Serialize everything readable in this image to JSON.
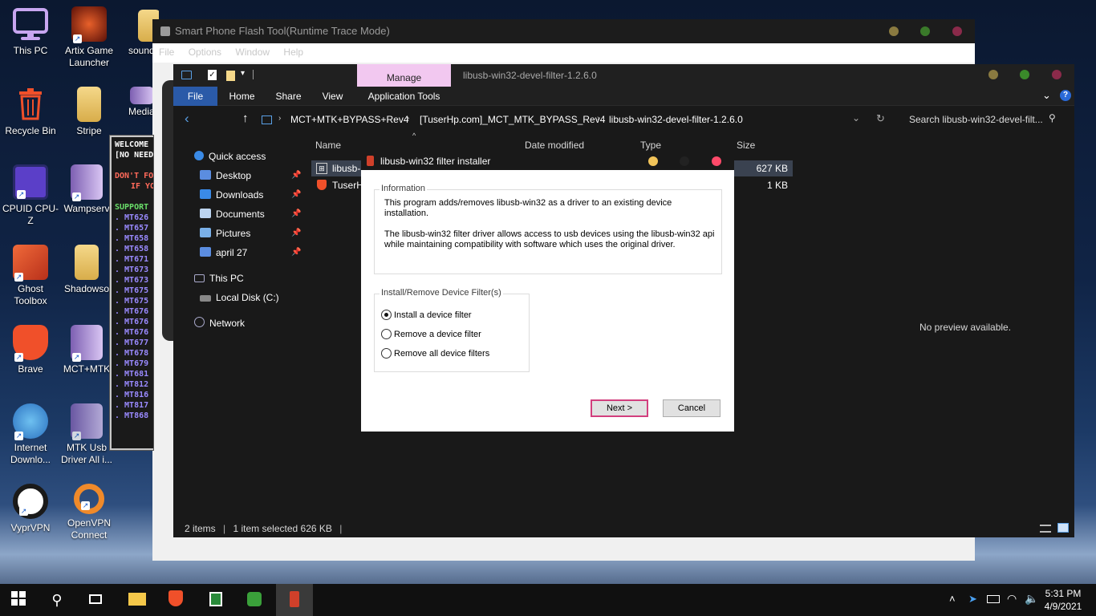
{
  "desktop": {
    "icons": [
      {
        "label": "This PC"
      },
      {
        "label": "Artix Game Launcher"
      },
      {
        "label": "sound"
      },
      {
        "label": "Recycle Bin"
      },
      {
        "label": "Stripe"
      },
      {
        "label": "Media"
      },
      {
        "label": "CPUID CPU-Z"
      },
      {
        "label": "Wampserv"
      },
      {
        "label": "Ghost Toolbox"
      },
      {
        "label": "Shadowso"
      },
      {
        "label": "Brave"
      },
      {
        "label": "MCT+MTK"
      },
      {
        "label": "Internet Downlo..."
      },
      {
        "label": "MTK Usb Driver All i..."
      },
      {
        "label": "VyprVPN"
      },
      {
        "label": "OpenVPN Connect"
      }
    ]
  },
  "cmd_panel": {
    "lines": [
      "WELCOME",
      "[NO NEED",
      "",
      "DON'T FO",
      "IF YO",
      "",
      "SUPPORT",
      "MT626",
      "MT657",
      "MT658",
      "MT658",
      "MT671",
      "MT673",
      "MT673",
      "MT675",
      "MT675",
      "MT676",
      "MT676",
      "MT676",
      "MT677",
      "MT678",
      "MT679",
      "MT681",
      "MT812",
      "MT816",
      "MT817",
      "MT868"
    ]
  },
  "flash_tool": {
    "title": "Smart Phone Flash Tool(Runtime Trace Mode)",
    "menu": [
      "File",
      "Options",
      "Window",
      "Help"
    ]
  },
  "explorer": {
    "context_tab": "Manage",
    "window_title": "libusb-win32-devel-filter-1.2.6.0",
    "tabs": [
      "File",
      "Home",
      "Share",
      "View",
      "Application Tools"
    ],
    "breadcrumb": [
      "MCT+MTK+BYPASS+Rev4",
      "[TuserHp.com]_MCT_MTK_BYPASS_Rev4",
      "libusb-win32-devel-filter-1.2.6.0"
    ],
    "search_placeholder": "Search libusb-win32-devel-filt...",
    "nav": {
      "quick_access": "Quick access",
      "items": [
        "Desktop",
        "Downloads",
        "Documents",
        "Pictures",
        "april 27"
      ],
      "this_pc": "This PC",
      "local_disk": "Local Disk (C:)",
      "network": "Network"
    },
    "columns": {
      "name": "Name",
      "date": "Date modified",
      "type": "Type",
      "size": "Size"
    },
    "files": [
      {
        "name": "libusb-",
        "size": "627 KB"
      },
      {
        "name": "TuserH",
        "size": "1 KB"
      }
    ],
    "preview": "No preview available.",
    "status": {
      "count": "2 items",
      "selected": "1 item selected  626 KB"
    }
  },
  "dialog": {
    "title": "libusb-win32 filter installer",
    "info_legend": "Information",
    "info_text_1": "This program adds/removes libusb-win32 as a driver to an existing device installation.",
    "info_text_2": "The libusb-win32 filter driver allows access to usb devices using the libusb-win32 api while maintaining compatibility with software which uses the original driver.",
    "group_legend": "Install/Remove Device Filter(s)",
    "options": [
      "Install a device filter",
      "Remove a device filter",
      "Remove all device filters"
    ],
    "selected_index": 0,
    "next": "Next >",
    "cancel": "Cancel"
  },
  "taskbar": {
    "time": "5:31 PM",
    "date": "4/9/2021"
  },
  "colors": {
    "manage_tab": "#f2c8f0",
    "dot_yellow": "#f2c45a",
    "dot_green": "#3a8a3a",
    "dot_red": "#ff4a6a",
    "next_border": "#d23f7e"
  }
}
